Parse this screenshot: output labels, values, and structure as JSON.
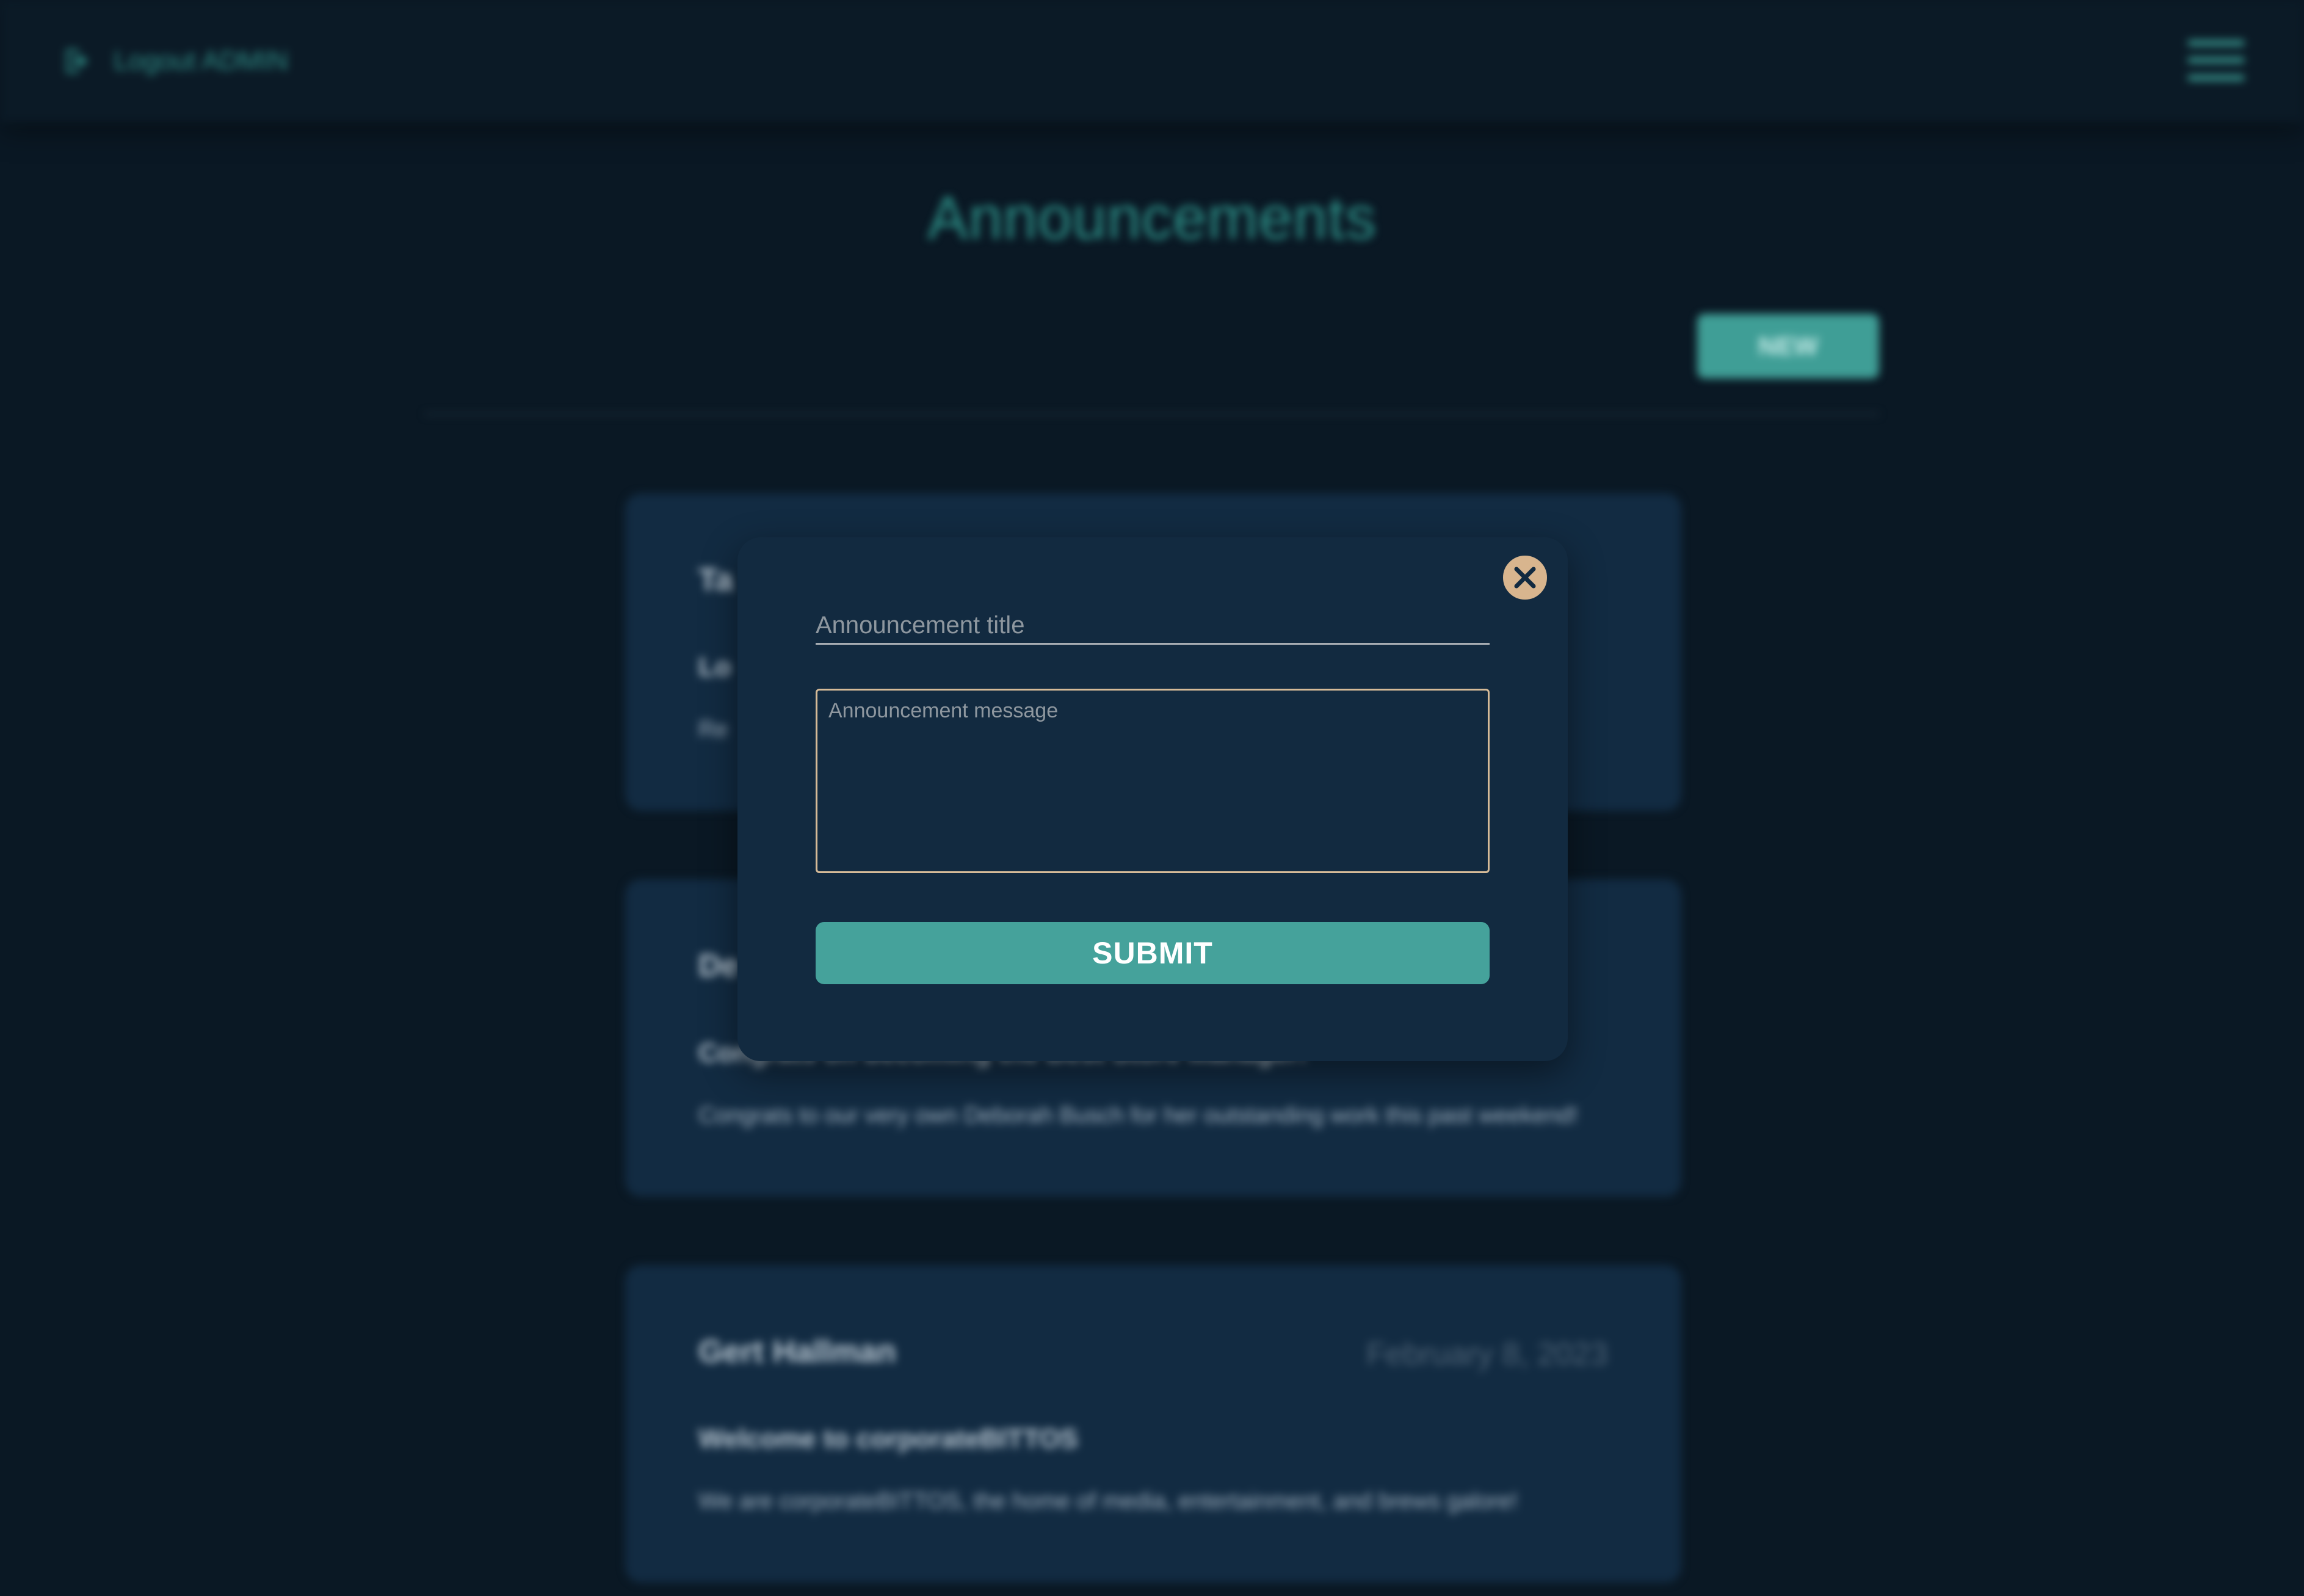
{
  "header": {
    "logout_label": "Logout ADMIN",
    "logout_icon": "logout-icon",
    "menu_icon": "hamburger-menu-icon"
  },
  "main": {
    "title": "Announcements",
    "new_button_label": "NEW",
    "cards": [
      {
        "name": "Ta",
        "date": "",
        "subject": "Lo",
        "body": "Re"
      },
      {
        "name": "De",
        "date": "",
        "subject": "Congrats on becoming the Best Store Manager!",
        "body": "Congrats to our very own Deborah Busch for her outstanding work this past weekend!"
      },
      {
        "name": "Gert Hallman",
        "date": "February 8, 2023",
        "subject": "Welcome to corporateBITTOS",
        "body": "We are corporateBITTOS, the home of media, entertainment, and brews galore!"
      }
    ]
  },
  "modal": {
    "title_placeholder": "Announcement title",
    "message_placeholder": "Announcement message",
    "submit_label": "SUBMIT",
    "close_icon": "close-icon"
  },
  "colors": {
    "background": "#0a1824",
    "accent": "#45a29b",
    "card": "#122b42",
    "close_button": "#d8b58e",
    "textarea_border": "#d6bb98"
  }
}
